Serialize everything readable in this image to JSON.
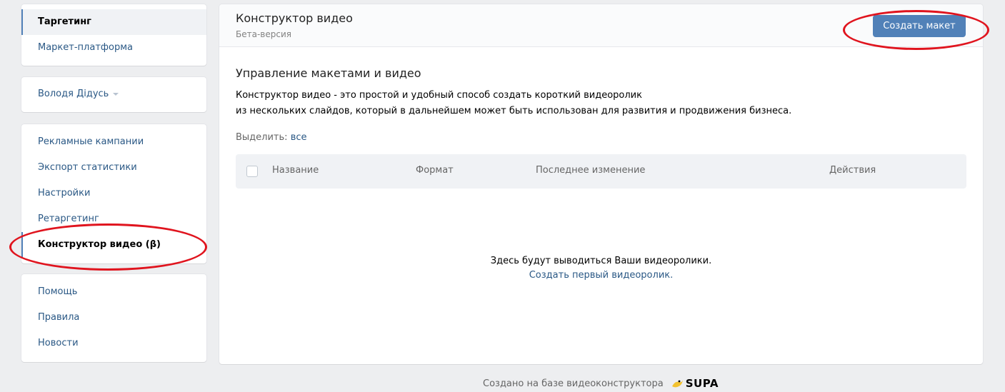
{
  "sidebar": {
    "group1": [
      {
        "label": "Таргетинг",
        "active": true
      },
      {
        "label": "Маркет-платформа",
        "active": false
      }
    ],
    "account": {
      "label": "Володя Дідусь"
    },
    "group3": [
      {
        "label": "Рекламные кампании",
        "active": false
      },
      {
        "label": "Экспорт статистики",
        "active": false
      },
      {
        "label": "Настройки",
        "active": false
      },
      {
        "label": "Ретаргетинг",
        "active": false
      },
      {
        "label": "Конструктор видео (β)",
        "active": true
      }
    ],
    "group4": [
      {
        "label": "Помощь"
      },
      {
        "label": "Правила"
      },
      {
        "label": "Новости"
      }
    ]
  },
  "main": {
    "header": {
      "title": "Конструктор видео",
      "subtitle": "Бета-версия",
      "create_button": "Создать макет"
    },
    "section_title": "Управление макетами и видео",
    "description": [
      "Конструктор видео - это простой и удобный способ создать короткий видеоролик",
      "из нескольких слайдов, который в дальнейшем может быть использован для развития и продвижения бизнеса."
    ],
    "select": {
      "label": "Выделить:",
      "all": "все"
    },
    "table": {
      "columns": [
        "Название",
        "Формат",
        "Последнее изменение",
        "Действия"
      ]
    },
    "empty": {
      "text": "Здесь будут выводиться Ваши видеоролики.",
      "link": "Создать первый видеоролик."
    }
  },
  "footer": {
    "text": "Создано на базе видеоконструктора",
    "logo": "SUPA"
  },
  "colors": {
    "accent": "#5181b8",
    "link": "#2a5885",
    "background": "#edeef0",
    "annotation": "#e0141e"
  }
}
